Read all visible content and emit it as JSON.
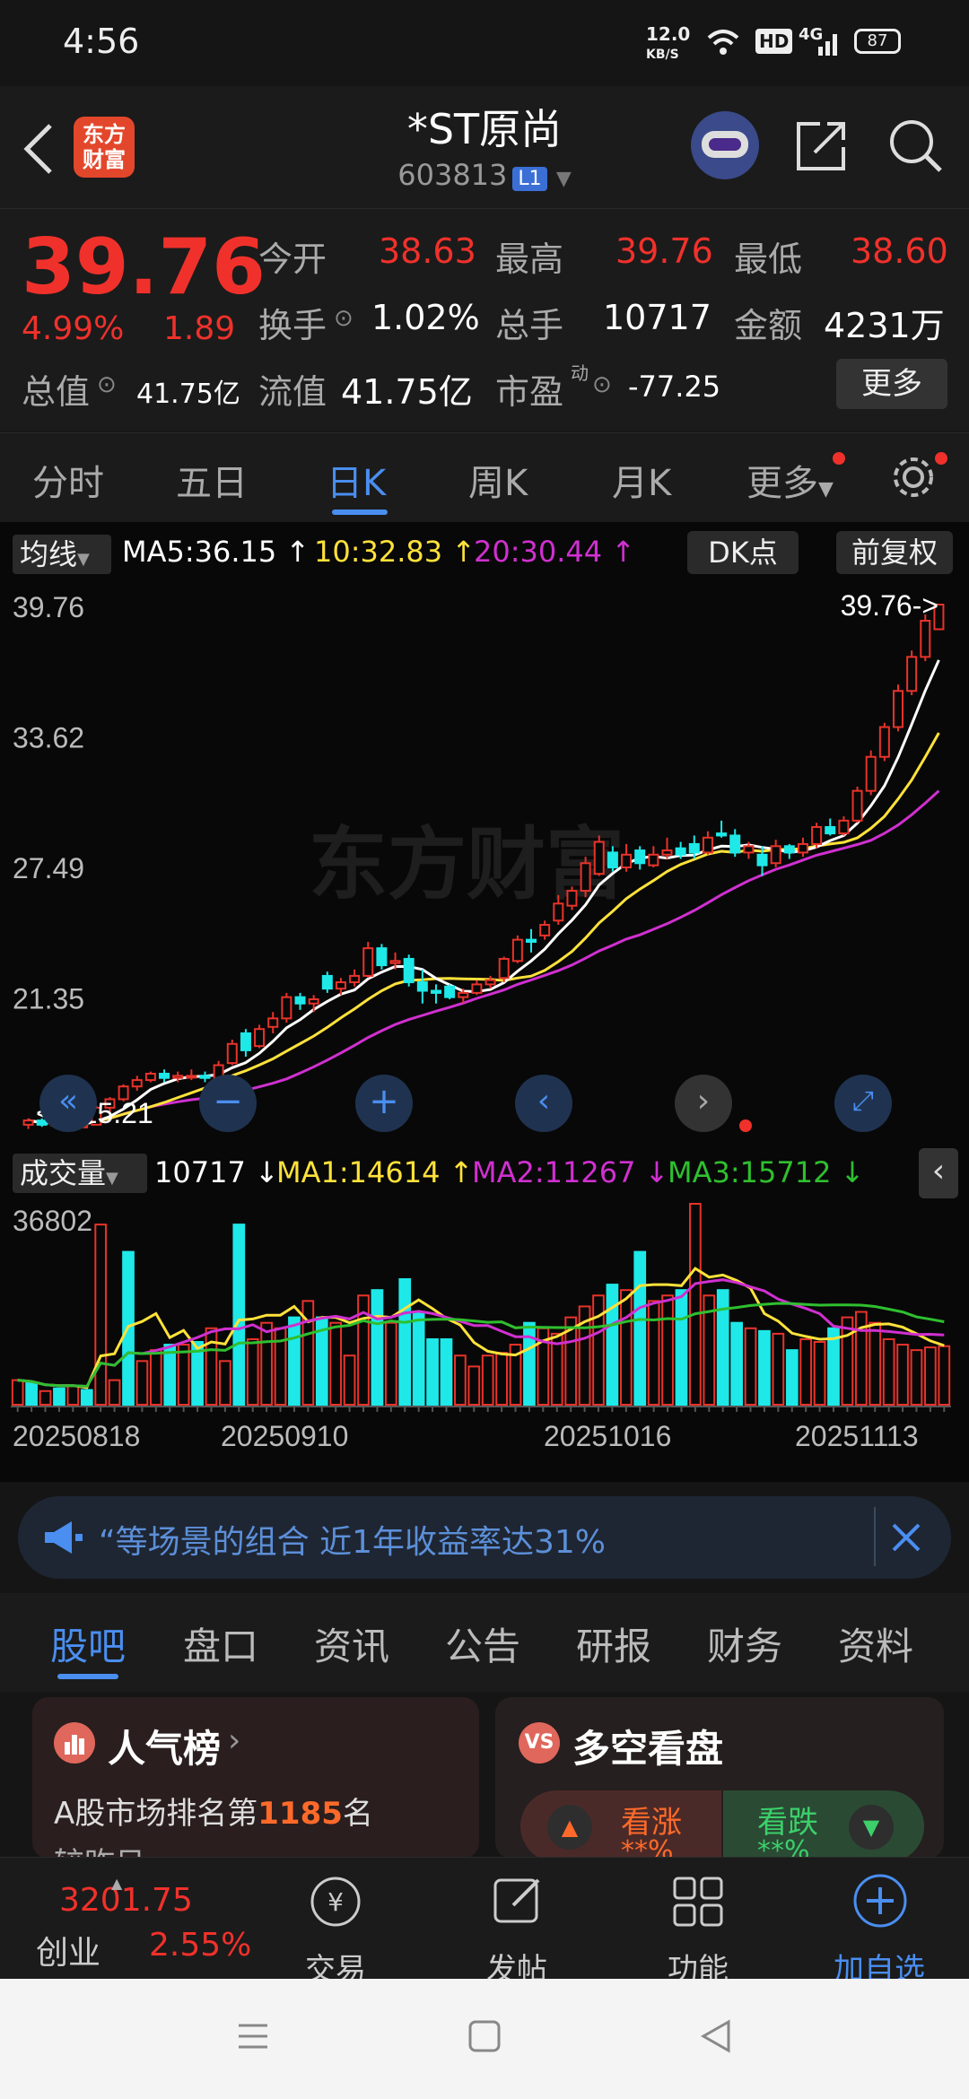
{
  "status": {
    "time": "4:56",
    "speed": "12.0",
    "speed_unit": "KB/S",
    "hd": "HD",
    "network": "4G",
    "battery": "87"
  },
  "header": {
    "logo_line1": "东方",
    "logo_line2": "财富",
    "title": "*ST原尚",
    "code": "603813",
    "level": "L1"
  },
  "quote": {
    "price": "39.76",
    "pct": "4.99%",
    "change": "1.89",
    "open_label": "今开",
    "open": "38.63",
    "high_label": "最高",
    "high": "39.76",
    "low_label": "最低",
    "low": "38.60",
    "turnover_label": "换手",
    "turnover": "1.02%",
    "volume_label": "总手",
    "volume": "10717",
    "amount_label": "金额",
    "amount": "4231万",
    "mcap_label": "总值",
    "mcap": "41.75亿",
    "float_label": "流值",
    "float": "41.75亿",
    "pe_label": "市盈",
    "pe_sup": "动",
    "pe": "-77.25",
    "more": "更多"
  },
  "tabs": [
    "分时",
    "五日",
    "日K",
    "周K",
    "月K",
    "更多"
  ],
  "ma_bar": {
    "label": "均线",
    "ma5": "MA5:36.15",
    "ma10": "10:32.83",
    "ma20": "20:30.44",
    "dk": "DK点",
    "fq": "前复权"
  },
  "vol_bar": {
    "label": "成交量",
    "vol": "10717",
    "ma1": "MA1:14614",
    "ma2": "MA2:11267",
    "ma3": "MA3:15712"
  },
  "chart_data": {
    "type": "candlestick",
    "y_ticks": [
      "39.76",
      "33.62",
      "27.49",
      "21.35",
      "15.21"
    ],
    "last_label": "39.76->",
    "min_label": "<---15.21",
    "watermark": "东方财富",
    "volume_max_label": "36802",
    "x_ticks": [
      "20250818",
      "20250910",
      "20251016",
      "20251113"
    ],
    "colors": {
      "up": "#e8332a",
      "down": "#1ee8e8",
      "ma5": "#ffffff",
      "ma10": "#ffe23a",
      "ma20": "#d030d0",
      "vma3": "#2fbf2f"
    },
    "candles": [
      [
        15.3,
        15.6,
        15.1,
        15.5
      ],
      [
        15.5,
        15.6,
        15.2,
        15.3
      ],
      [
        15.3,
        15.4,
        15.2,
        15.35
      ],
      [
        15.35,
        15.5,
        15.2,
        15.25
      ],
      [
        15.25,
        15.3,
        15.21,
        15.26
      ],
      [
        15.3,
        16.2,
        15.3,
        16.1
      ],
      [
        16.1,
        16.6,
        15.9,
        16.5
      ],
      [
        16.5,
        17.2,
        16.4,
        17.1
      ],
      [
        17.1,
        17.6,
        16.9,
        17.4
      ],
      [
        17.4,
        17.8,
        17.3,
        17.7
      ],
      [
        17.7,
        17.9,
        17.3,
        17.5
      ],
      [
        17.5,
        17.8,
        17.3,
        17.6
      ],
      [
        17.6,
        17.9,
        17.4,
        17.6
      ],
      [
        17.6,
        17.8,
        17.3,
        17.5
      ],
      [
        17.5,
        18.3,
        17.4,
        18.1
      ],
      [
        18.2,
        19.3,
        18.1,
        19.1
      ],
      [
        19.6,
        19.8,
        18.5,
        18.8
      ],
      [
        19.0,
        20.0,
        18.9,
        19.8
      ],
      [
        19.9,
        20.6,
        19.6,
        20.3
      ],
      [
        20.3,
        21.5,
        20.1,
        21.3
      ],
      [
        21.3,
        21.5,
        20.7,
        21.0
      ],
      [
        21.0,
        21.4,
        20.6,
        21.2
      ],
      [
        22.3,
        22.5,
        21.5,
        21.7
      ],
      [
        21.7,
        22.2,
        21.4,
        22.0
      ],
      [
        22.0,
        22.6,
        21.8,
        22.3
      ],
      [
        22.3,
        23.9,
        22.2,
        23.6
      ],
      [
        23.6,
        23.8,
        22.6,
        22.8
      ],
      [
        22.9,
        23.4,
        22.6,
        23.0
      ],
      [
        23.1,
        23.3,
        21.8,
        22.0
      ],
      [
        22.0,
        22.6,
        21.0,
        21.6
      ],
      [
        21.6,
        21.9,
        21.0,
        21.5
      ],
      [
        21.8,
        21.9,
        21.2,
        21.3
      ],
      [
        21.3,
        21.7,
        21.0,
        21.5
      ],
      [
        21.5,
        22.1,
        21.4,
        21.9
      ],
      [
        21.9,
        22.3,
        21.7,
        22.1
      ],
      [
        22.2,
        23.2,
        22.0,
        23.1
      ],
      [
        23.0,
        24.2,
        22.9,
        24.0
      ],
      [
        24.0,
        24.5,
        23.4,
        23.9
      ],
      [
        24.2,
        24.9,
        24.0,
        24.7
      ],
      [
        24.9,
        26.1,
        24.7,
        25.7
      ],
      [
        25.6,
        26.5,
        25.4,
        26.3
      ],
      [
        26.3,
        27.9,
        26.0,
        27.6
      ],
      [
        27.1,
        28.9,
        27.0,
        28.6
      ],
      [
        28.1,
        28.4,
        27.2,
        27.4
      ],
      [
        27.4,
        28.5,
        27.2,
        28.0
      ],
      [
        28.2,
        28.4,
        27.3,
        27.6
      ],
      [
        27.5,
        28.4,
        27.4,
        28.0
      ],
      [
        28.0,
        28.8,
        27.8,
        28.2
      ],
      [
        28.3,
        28.6,
        27.8,
        28.0
      ],
      [
        28.5,
        28.9,
        27.8,
        28.1
      ],
      [
        28.1,
        29.1,
        28.0,
        28.8
      ],
      [
        29.0,
        29.6,
        28.8,
        28.9
      ],
      [
        28.9,
        29.2,
        27.9,
        28.1
      ],
      [
        28.1,
        28.6,
        27.8,
        28.4
      ],
      [
        28.0,
        28.4,
        27.0,
        27.5
      ],
      [
        27.6,
        28.7,
        27.4,
        28.4
      ],
      [
        28.4,
        28.5,
        27.8,
        28.1
      ],
      [
        28.1,
        28.8,
        27.9,
        28.5
      ],
      [
        28.5,
        29.5,
        28.3,
        29.3
      ],
      [
        29.3,
        29.7,
        28.9,
        29.0
      ],
      [
        29.0,
        29.8,
        28.9,
        29.6
      ],
      [
        29.6,
        31.2,
        29.5,
        31.0
      ],
      [
        31.0,
        32.9,
        30.8,
        32.6
      ],
      [
        32.6,
        34.2,
        32.4,
        34.0
      ],
      [
        34.0,
        36.0,
        33.8,
        35.7
      ],
      [
        35.7,
        37.6,
        35.5,
        37.3
      ],
      [
        37.3,
        39.3,
        37.1,
        39.0
      ],
      [
        38.6,
        39.76,
        38.6,
        39.76
      ]
    ],
    "volumes": [
      4.5,
      4.0,
      2.5,
      3.0,
      3.5,
      2.7,
      33.0,
      4.5,
      28.0,
      8.0,
      10.0,
      11.0,
      11.0,
      11.5,
      14.0,
      8.0,
      33.0,
      12.0,
      15.0,
      14.0,
      16.0,
      19.0,
      16.0,
      15.0,
      9.0,
      20.0,
      21.0,
      15.0,
      23.0,
      17.0,
      12.0,
      12.0,
      9.0,
      7.0,
      9.0,
      9.5,
      11.0,
      15.0,
      14.0,
      13.0,
      16.0,
      18.0,
      20.0,
      22.0,
      21.0,
      28.0,
      19.0,
      20.0,
      21.0,
      36.8,
      20.0,
      21.0,
      15.0,
      14.0,
      13.5,
      13.0,
      10.0,
      12.0,
      11.5,
      14.0,
      16.0,
      17.0,
      15.0,
      12.0,
      11.0,
      10.0,
      10.5,
      10.717
    ],
    "volume_up": [
      1,
      0,
      1,
      0,
      1,
      0,
      1,
      1,
      0,
      1,
      1,
      0,
      1,
      0,
      1,
      1,
      0,
      1,
      1,
      1,
      0,
      1,
      0,
      1,
      1,
      1,
      0,
      1,
      0,
      0,
      0,
      0,
      1,
      1,
      1,
      1,
      1,
      0,
      1,
      1,
      1,
      1,
      1,
      0,
      1,
      0,
      1,
      1,
      0,
      1,
      1,
      0,
      0,
      1,
      0,
      1,
      0,
      1,
      1,
      0,
      1,
      1,
      1,
      1,
      1,
      1,
      1,
      1
    ]
  },
  "banner": {
    "text": "“等场景的组合 近1年收益率达31%"
  },
  "info_tabs": [
    "股吧",
    "盘口",
    "资讯",
    "公告",
    "研报",
    "财务",
    "资料"
  ],
  "cards": {
    "hot_title": "人气榜",
    "hot_rank_pre": "A股市场排名第",
    "hot_rank": "1185",
    "hot_rank_post": "名",
    "hot_sub": "较昨日",
    "ls_title": "多空看盘",
    "bull": "看涨",
    "bear": "看跌",
    "bull_val": "**%",
    "bear_val": "**%"
  },
  "bottom_nav": {
    "index_value": "3201.75",
    "index_name": "创业",
    "index_pct": "2.55%",
    "trade": "交易",
    "post": "发帖",
    "func": "功能",
    "watch": "加自选"
  }
}
